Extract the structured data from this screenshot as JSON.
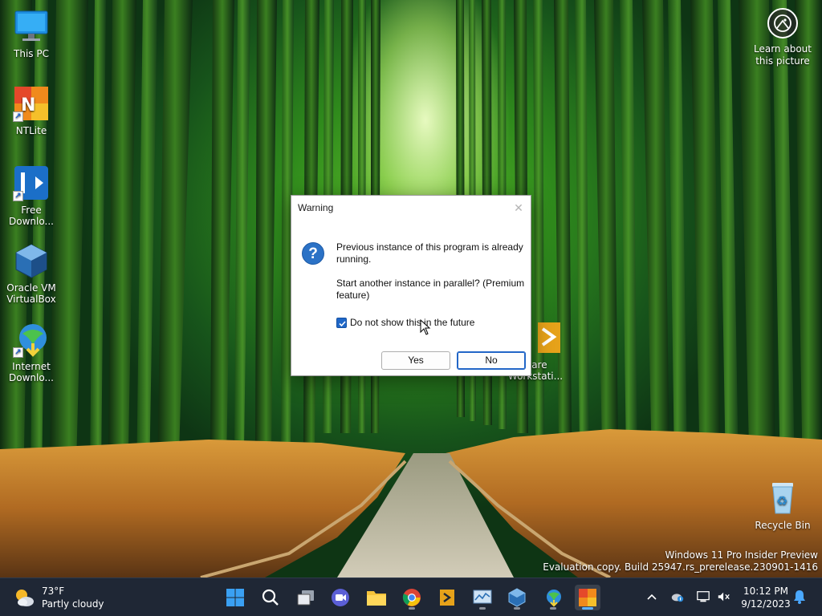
{
  "desktop": {
    "icons": [
      {
        "label": "This PC"
      },
      {
        "label": "NTLite"
      },
      {
        "label": "Free Downlo..."
      },
      {
        "label": "Oracle VM VirtualBox"
      },
      {
        "label": "Internet Downlo..."
      },
      {
        "label": "ware Workstati..."
      },
      {
        "label": "Recycle Bin"
      }
    ],
    "learn_label": "Learn about this picture",
    "watermark": {
      "line1": "Windows 11 Pro Insider Preview",
      "line2": "Evaluation copy. Build 25947.rs_prerelease.230901-1416"
    }
  },
  "dialog": {
    "title": "Warning",
    "close_glyph": "✕",
    "icon_glyph": "?",
    "message_line1": "Previous instance of this program is already running.",
    "message_line2": "Start another instance in parallel? (Premium feature)",
    "checkbox_label": "Do not show this in the future",
    "checkbox_checked": true,
    "yes_label": "Yes",
    "no_label": "No"
  },
  "taskbar": {
    "weather_temp": "73°F",
    "weather_desc": "Partly cloudy",
    "apps": [
      {
        "name": "start-button"
      },
      {
        "name": "search-button"
      },
      {
        "name": "task-view-button"
      },
      {
        "name": "meet-now-button"
      },
      {
        "name": "file-explorer-button"
      },
      {
        "name": "chrome-button"
      },
      {
        "name": "vmware-workstation-button"
      },
      {
        "name": "resource-monitor-button"
      },
      {
        "name": "virtualbox-button"
      },
      {
        "name": "internet-download-manager-button"
      },
      {
        "name": "ntlite-button"
      }
    ],
    "clock_time": "10:12 PM",
    "clock_date": "9/12/2023"
  },
  "colors": {
    "taskbar_bg": "#1f2735",
    "accent": "#1f67c7",
    "dialog_bg": "#ffffff"
  }
}
